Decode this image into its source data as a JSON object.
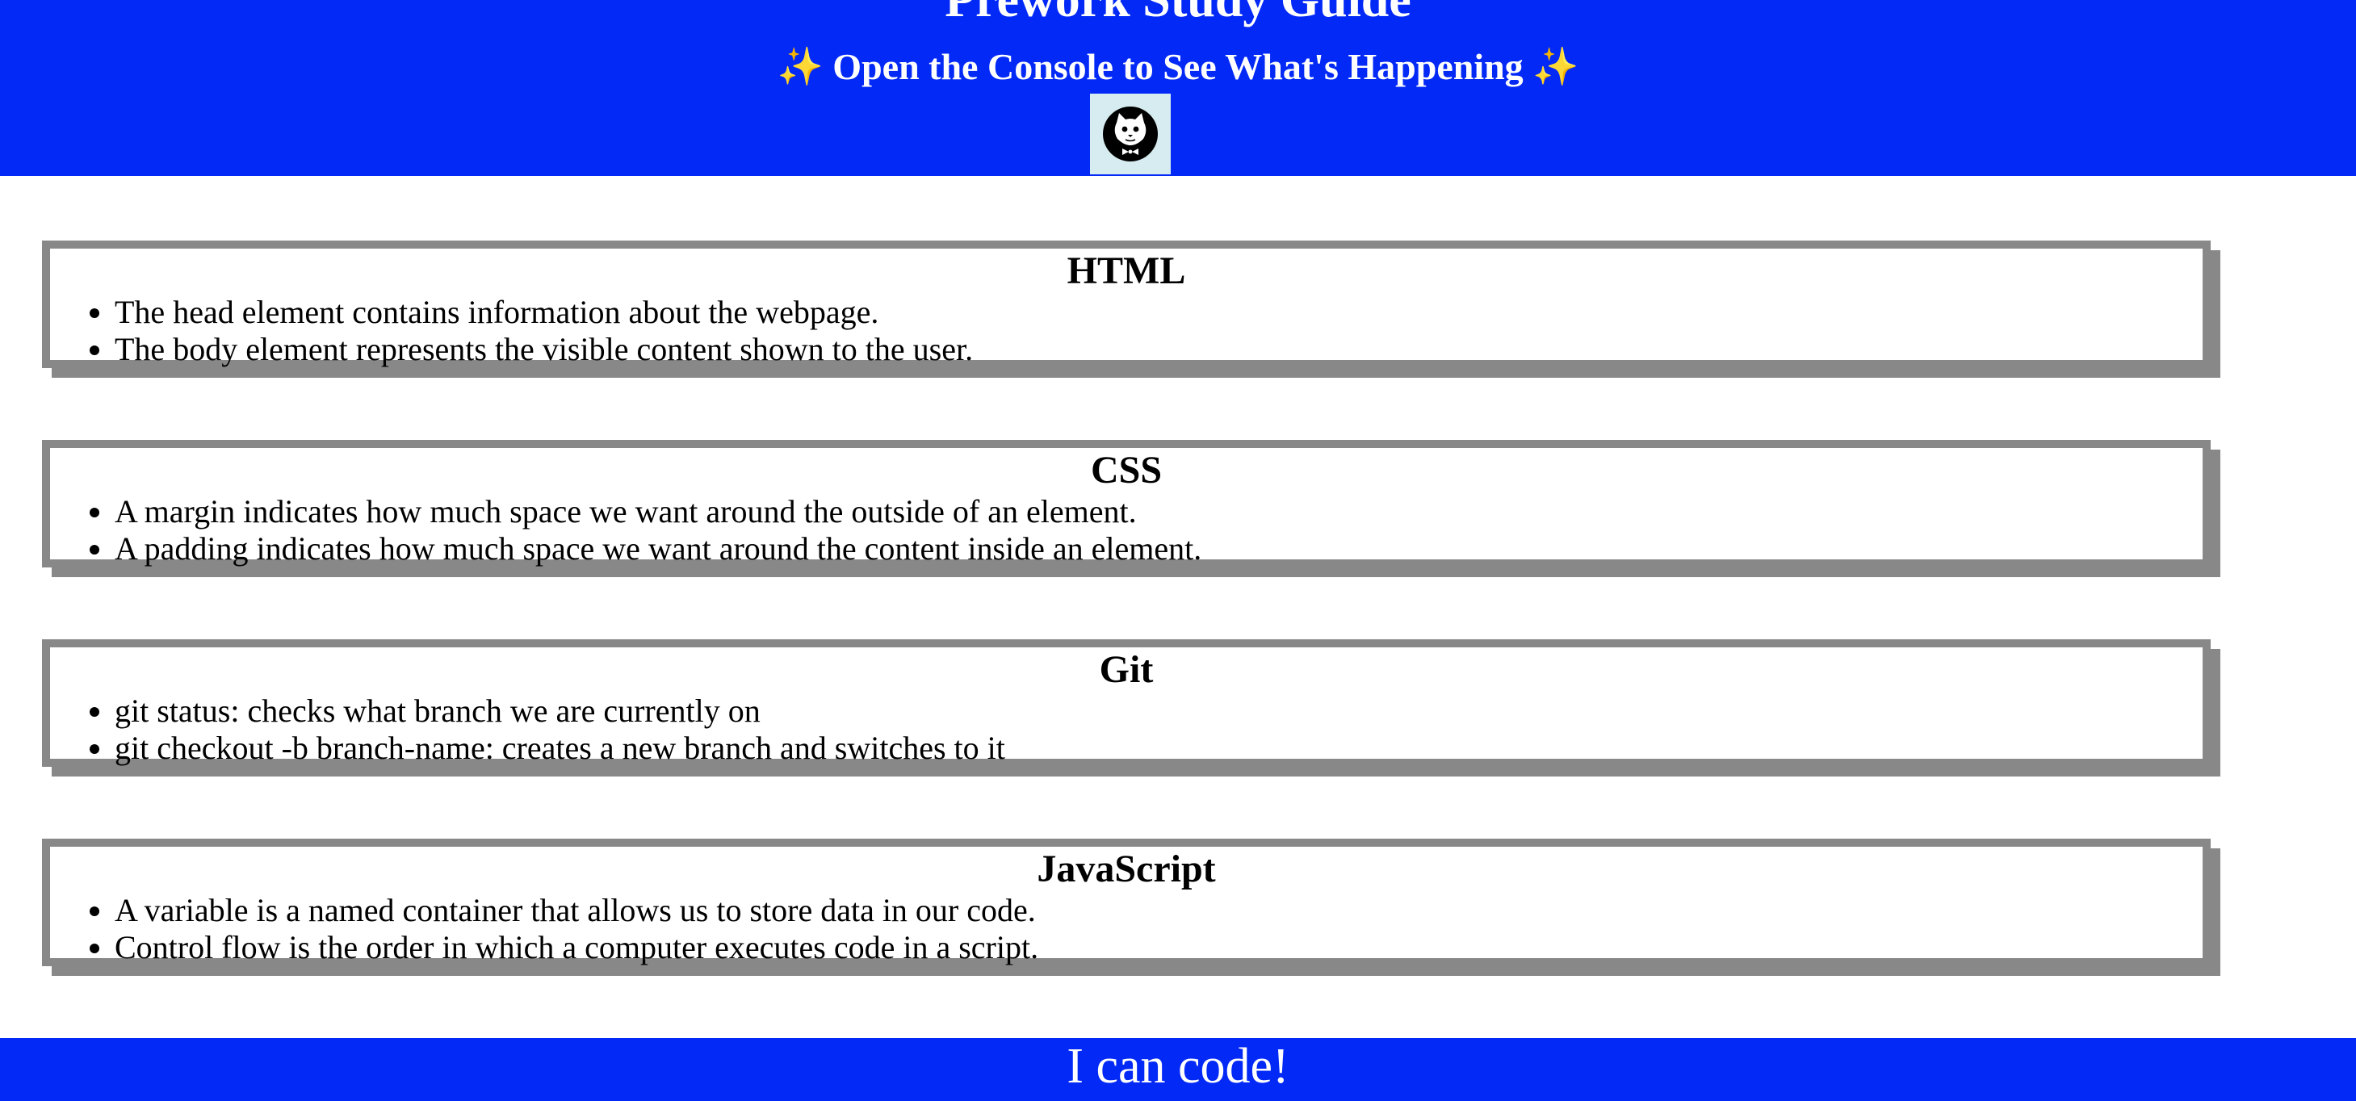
{
  "header": {
    "title": "Prework Study Guide",
    "subtitle_sparkle_left": "✨",
    "subtitle_text": "Open the Console to See What's Happening",
    "subtitle_sparkle_right": "✨",
    "logo_icon": "cat-logo-icon"
  },
  "sections": [
    {
      "title": "HTML",
      "items": [
        "The head element contains information about the webpage.",
        "The body element represents the visible content shown to the user."
      ]
    },
    {
      "title": "CSS",
      "items": [
        "A margin indicates how much space we want around the outside of an element.",
        "A padding indicates how much space we want around the content inside an element."
      ]
    },
    {
      "title": "Git",
      "items": [
        "git status: checks what branch we are currently on",
        "git checkout -b branch-name: creates a new branch and switches to it"
      ]
    },
    {
      "title": "JavaScript",
      "items": [
        "A variable is a named container that allows us to store data in our code.",
        "Control flow is the order in which a computer executes code in a script."
      ]
    }
  ],
  "footer": {
    "text": "I can code!"
  },
  "colors": {
    "header_bg": "#0329f7",
    "card_border": "#888888",
    "logo_bg": "#d6ecf0",
    "sparkle": "#ffd84a"
  }
}
